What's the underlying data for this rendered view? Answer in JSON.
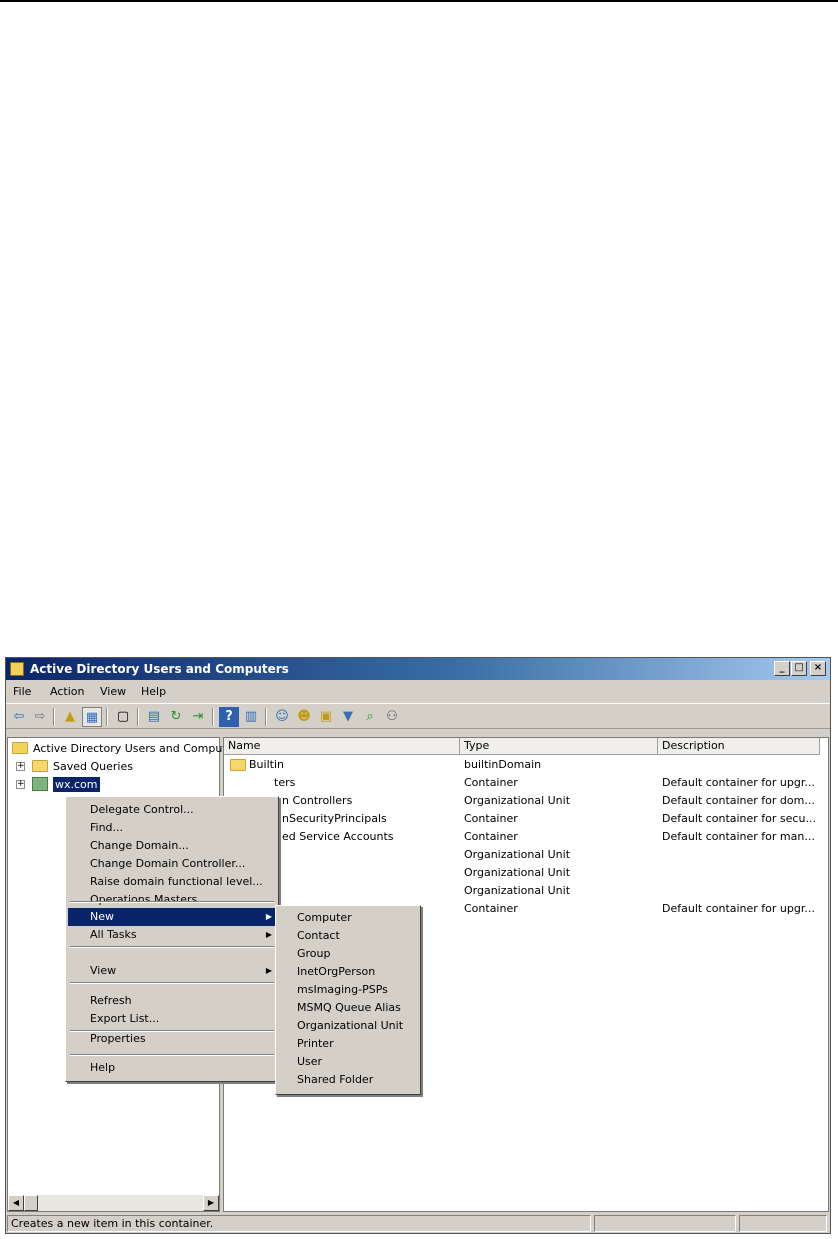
{
  "window": {
    "title": "Active Directory Users and Computers",
    "controls": {
      "minimize": "_",
      "maximize": "□",
      "close": "×"
    }
  },
  "menubar": {
    "items": [
      "File",
      "Action",
      "View",
      "Help"
    ]
  },
  "toolbar": {
    "icons": [
      "back-arrow-icon",
      "forward-arrow-icon",
      "up-folder-icon",
      "show-console-tree-icon",
      "copy-icon",
      "properties-sheet-icon",
      "refresh-icon",
      "export-list-icon",
      "help-icon",
      "details-view-icon",
      "new-user-icon",
      "new-group-icon",
      "new-ou-icon",
      "filter-icon",
      "find-icon",
      "delegate-icon"
    ]
  },
  "tree": {
    "root": "Active Directory Users and Comput",
    "saved_queries": "Saved Queries",
    "domain": "wx.com"
  },
  "list": {
    "columns": [
      "Name",
      "Type",
      "Description"
    ],
    "rows": [
      {
        "name": "Builtin",
        "type": "builtinDomain",
        "description": ""
      },
      {
        "name": "Computers",
        "type": "Container",
        "description": "Default container for upgr..."
      },
      {
        "name": "Domain Controllers",
        "type": "Organizational Unit",
        "description": "Default container for dom..."
      },
      {
        "name": "ForeignSecurityPrincipals",
        "type": "Container",
        "description": "Default container for secu..."
      },
      {
        "name": "Managed Service Accounts",
        "type": "Container",
        "description": "Default container for man..."
      },
      {
        "name": "",
        "type": "Organizational Unit",
        "description": ""
      },
      {
        "name": "",
        "type": "Organizational Unit",
        "description": ""
      },
      {
        "name": "",
        "type": "Organizational Unit",
        "description": ""
      },
      {
        "name": "",
        "type": "Container",
        "description": "Default container for upgr..."
      }
    ],
    "visible_name_fragments": [
      "Builtin",
      "ters",
      "n Controllers",
      "nSecurityPrincipals",
      "ed Service Accounts"
    ]
  },
  "context_menu": {
    "items": [
      "Delegate Control...",
      "Find...",
      "Change Domain...",
      "Change Domain Controller...",
      "Raise domain functional level...",
      "Operations Masters...",
      "New",
      "All Tasks",
      "View",
      "Refresh",
      "Export List...",
      "Properties",
      "Help"
    ],
    "highlighted": "New"
  },
  "submenu": {
    "items": [
      "Computer",
      "Contact",
      "Group",
      "InetOrgPerson",
      "msImaging-PSPs",
      "MSMQ Queue Alias",
      "Organizational Unit",
      "Printer",
      "User",
      "Shared Folder"
    ]
  },
  "statusbar": {
    "text": "Creates a new item in this container."
  },
  "colors": {
    "highlight": "#0a246a",
    "chrome": "#d4d0c8",
    "title_start": "#0a246a",
    "title_end": "#a6caf0"
  }
}
